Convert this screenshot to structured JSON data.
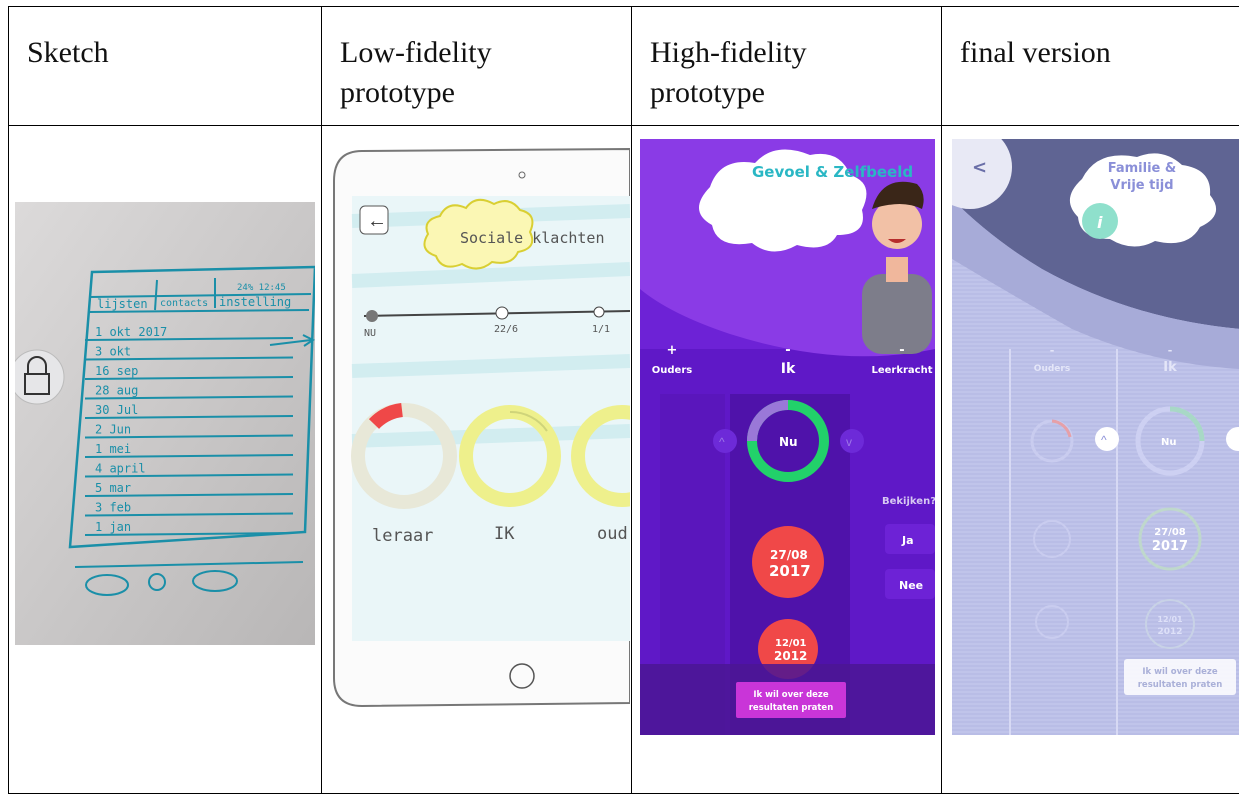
{
  "columns": [
    {
      "header": "Sketch"
    },
    {
      "header": "Low-fidelity\nprototype"
    },
    {
      "header": "High-fidelity\nprototype"
    },
    {
      "header": "final version"
    }
  ],
  "sketch": {
    "tabs": [
      "lijsten",
      "contacts",
      "instelling"
    ],
    "rows": [
      "1 okt 2017",
      "3 okt",
      "16 sep",
      "28 aug",
      "30 Jul",
      "2 Jun",
      "1 mei",
      "4 april",
      "5 mar",
      "3 feb",
      "1 jan"
    ]
  },
  "lofi": {
    "title": "Sociale klachten",
    "timeline": [
      "NU",
      "22/6",
      "1/1"
    ],
    "labels": [
      "leraar",
      "IK",
      "oud"
    ]
  },
  "hifi": {
    "title": "Gevoel & Zelfbeeld",
    "columns": [
      {
        "sign": "+",
        "label": "Ouders"
      },
      {
        "sign": "-",
        "label": "Ik"
      },
      {
        "sign": "-",
        "label": "Leerkracht"
      }
    ],
    "nu_label": "Nu",
    "date1_day": "27/08",
    "date1_year": "2017",
    "date2_day": "12/01",
    "date2_year": "2012",
    "bekijken": "Bekijken?",
    "ja": "Ja",
    "nee": "Nee",
    "cta": "Ik wil over deze resultaten praten"
  },
  "final": {
    "title": "Familie & Vrije tijd",
    "back": "<",
    "info": "i",
    "columns": [
      {
        "sign": "-",
        "label": "Ouders"
      },
      {
        "sign": "-",
        "label": "Ik"
      }
    ],
    "nu_label": "Nu",
    "date1_day": "27/08",
    "date1_year": "2017",
    "date2_day": "12/01",
    "date2_year": "2012",
    "cta": "Ik wil over deze resultaten praten"
  },
  "colors": {
    "hifi_purple": "#6d22d6",
    "hifi_green": "#22d16a",
    "hifi_red": "#f04848",
    "hifi_teal": "#3fb8c8",
    "final_bg": "#b9bde6",
    "sketch_ink": "#1a8fa8"
  }
}
